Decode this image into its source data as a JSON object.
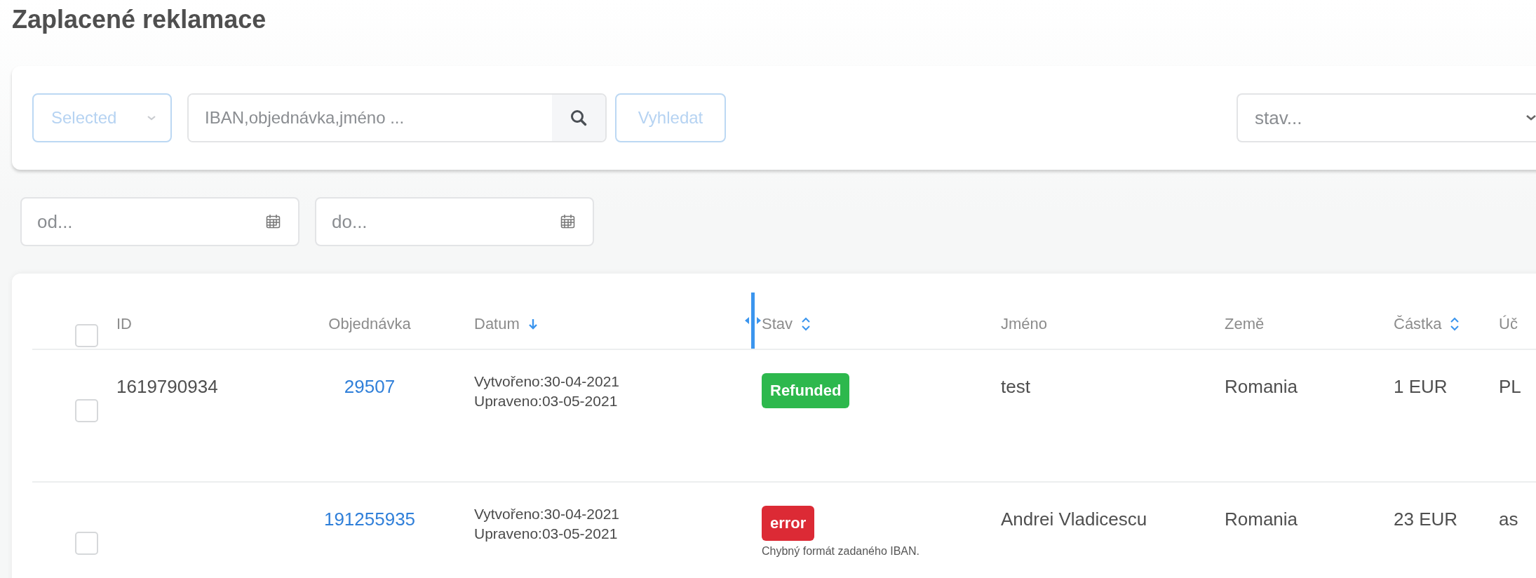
{
  "title": "Zaplacené reklamace",
  "filters": {
    "scope": {
      "value": "Selected"
    },
    "search": {
      "placeholder": "IBAN,objednávka,jméno ..."
    },
    "search_button": "Vyhledat",
    "status_select": {
      "placeholder": "stav..."
    },
    "date_from": {
      "placeholder": "od..."
    },
    "date_to": {
      "placeholder": "do..."
    }
  },
  "table": {
    "select_all": {
      "checked": false
    },
    "columns": [
      {
        "label": "ID"
      },
      {
        "label": "Objednávka"
      },
      {
        "label": "Datum",
        "sorted_descending": true,
        "resize_handle": true
      },
      {
        "label": "Stav",
        "sortable": true
      },
      {
        "label": "Jméno"
      },
      {
        "label": "Země"
      },
      {
        "label": "Částka",
        "sortable": true
      },
      {
        "label": "Úč"
      }
    ],
    "rows": [
      {
        "checked": false,
        "id": "1619790934",
        "order": "29507",
        "created": "Vytvořeno:30-04-2021",
        "updated": "Upraveno:03-05-2021",
        "status": {
          "label": "Refunded",
          "kind": "success"
        },
        "name": "test",
        "country": "Romania",
        "amount": "1 EUR",
        "column_8": "PL"
      },
      {
        "checked": false,
        "order": "191255935",
        "created": "Vytvořeno:30-04-2021",
        "updated": "Upraveno:03-05-2021",
        "status": {
          "label": "error",
          "kind": "error",
          "message": "Chybný formát zadaného IBAN."
        },
        "name": "Andrei Vladicescu",
        "country": "Romania",
        "amount": "23 EUR",
        "column_8": "as"
      }
    ]
  }
}
